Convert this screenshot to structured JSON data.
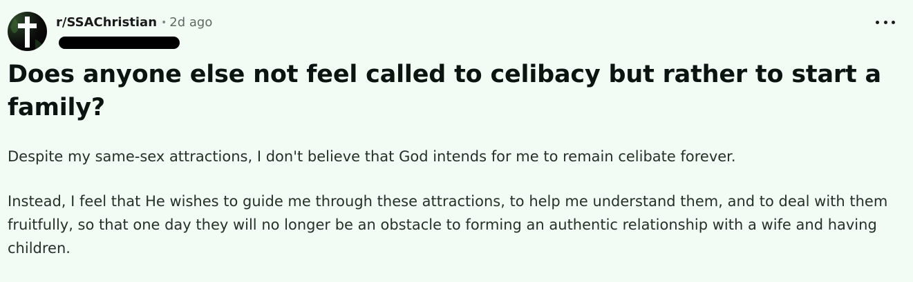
{
  "post": {
    "subreddit": "r/SSAChristian",
    "separator": "•",
    "time_ago": "2d ago",
    "avatar_icon": "cross-icon",
    "more_icon": "ellipsis-icon",
    "title": "Does anyone else not feel called to celibacy but rather to start a family?",
    "paragraphs": [
      "Despite my same-sex attractions, I don't believe that God intends for me to remain celibate forever.",
      "Instead, I feel that He wishes to guide me through these attractions, to help me understand them, and to deal with them fruitfully, so that one day they will no longer be an obstacle to forming an authentic relationship with a wife and having children."
    ]
  },
  "colors": {
    "background": "#f2fbf4",
    "title_text": "#0b1410",
    "body_text": "#24302a",
    "meta_text": "#5d6b61",
    "redaction": "#000000"
  }
}
